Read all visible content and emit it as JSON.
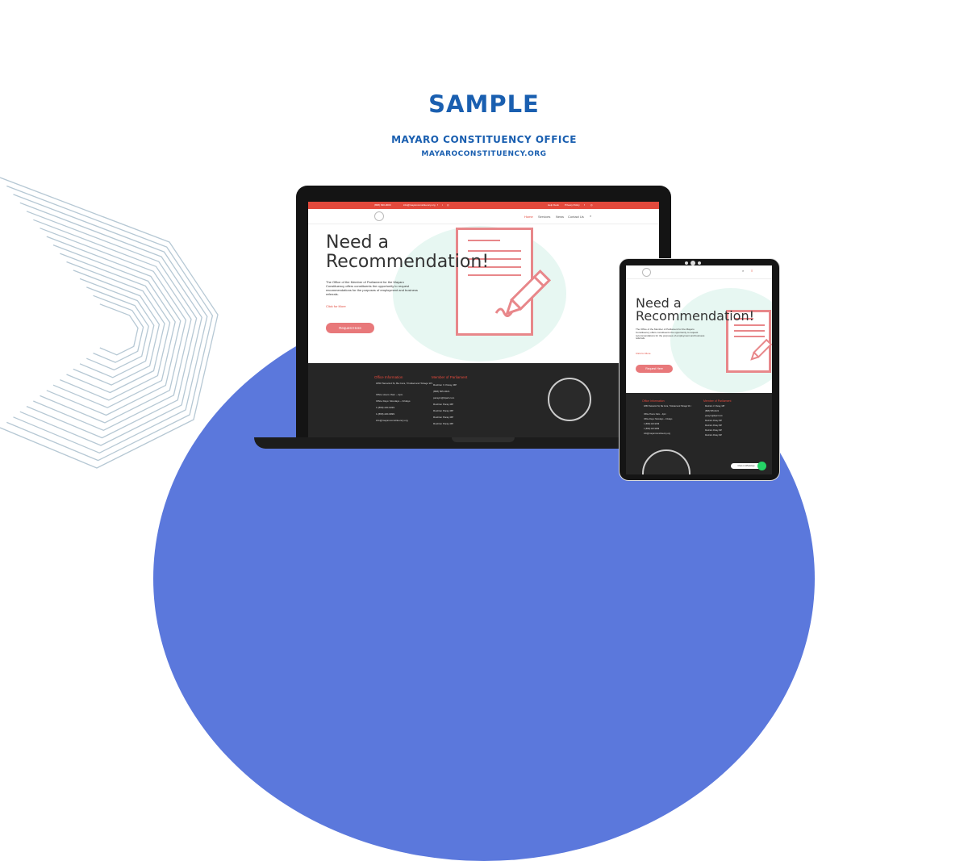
{
  "header": {
    "title": "SAMPLE",
    "subtitle": "MAYARO CONSTITUENCY OFFICE",
    "url": "MAYAROCONSTITUENCY.ORG"
  },
  "colors": {
    "brand_blue": "#1a5fb0",
    "blob_blue": "#5b78dc",
    "accent_red": "#e2493c",
    "button_pink": "#e8787a",
    "hero_mint": "#e7f7f2",
    "footer_dark": "#262626"
  },
  "site": {
    "topbar": {
      "phone": "(868) 630-0000",
      "email": "info@mayaroconstituency.org",
      "social_icons": [
        "facebook-icon",
        "twitter-icon",
        "instagram-icon"
      ],
      "links": [
        "Help Desk",
        "Privacy Policy"
      ]
    },
    "nav": {
      "items": [
        "Home",
        "Services",
        "News",
        "Contact Us"
      ],
      "active": "Home",
      "search_icon": "search-icon"
    },
    "hero": {
      "headline_line1": "Need a",
      "headline_line2": "Recommendation!",
      "paragraph": "The Office of the Member of Parliament for the Mayaro Constituency offers constituents the opportunity to request recommendations for the purposes of employment and business referrals.",
      "link": "Click for More",
      "button": "Request Here"
    },
    "footer": {
      "office_heading": "Office Information",
      "office_items": [
        "1850 Tamarind St, Ba Cora, Trinidad and Tobago W.I.",
        "Office Hours: 8am – 4pm",
        "Office Days: Mondays – Fridays",
        "1 (868) 220-9339",
        "1 (868) 220-9999",
        "info@mayaroconstituency.org"
      ],
      "member_heading": "Member of Parliament",
      "member_items": [
        "Rushton V. Paray, MP",
        "(868) 505-0221",
        "paraym@ttparl.com",
        "Rushton Paray MP",
        "Rushton Paray MP",
        "Rushton Paray MP",
        "Rushton Paray MP"
      ]
    },
    "chat_label": "Chat on WhatsApp"
  }
}
